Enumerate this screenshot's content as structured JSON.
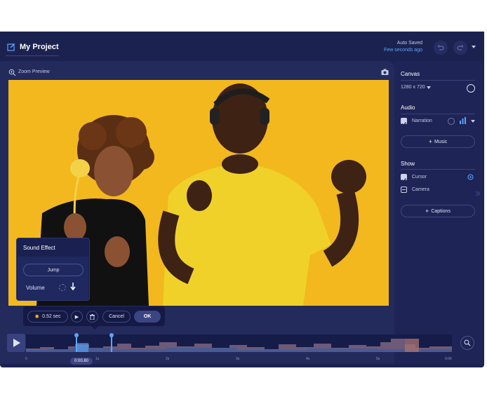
{
  "header": {
    "project_title": "My Project",
    "autosave_line1": "Auto Saved",
    "autosave_line2": "Few seconds ago"
  },
  "preview": {
    "zoom_label": "Zoom Preview"
  },
  "sidebar": {
    "canvas": {
      "title": "Canvas",
      "resolution": "1280 x 720"
    },
    "audio": {
      "title": "Audio",
      "narration_label": "Narration",
      "music_button": "Music"
    },
    "show": {
      "title": "Show",
      "cursor_label": "Cursor",
      "camera_label": "Camera",
      "captions_button": "Captions"
    }
  },
  "sound_effect": {
    "title": "Sound Effect",
    "jump_button": "Jump",
    "volume_label": "Volume"
  },
  "toolbar": {
    "duration": "0.52 sec",
    "cancel_label": "Cancel",
    "ok_label": "OK"
  },
  "timeline": {
    "current_time": "0:00.80",
    "start_label": "0",
    "tick_labels": [
      "1s",
      "2s",
      "3s",
      "4s",
      "5s"
    ],
    "end_label": "0:06"
  },
  "colors": {
    "app_bg": "#1c2250",
    "panel_bg": "#232a5c",
    "accent_blue": "#5aa6ff",
    "photo_yellow": "#f2b81d",
    "waveform": "#7a6a8c"
  }
}
